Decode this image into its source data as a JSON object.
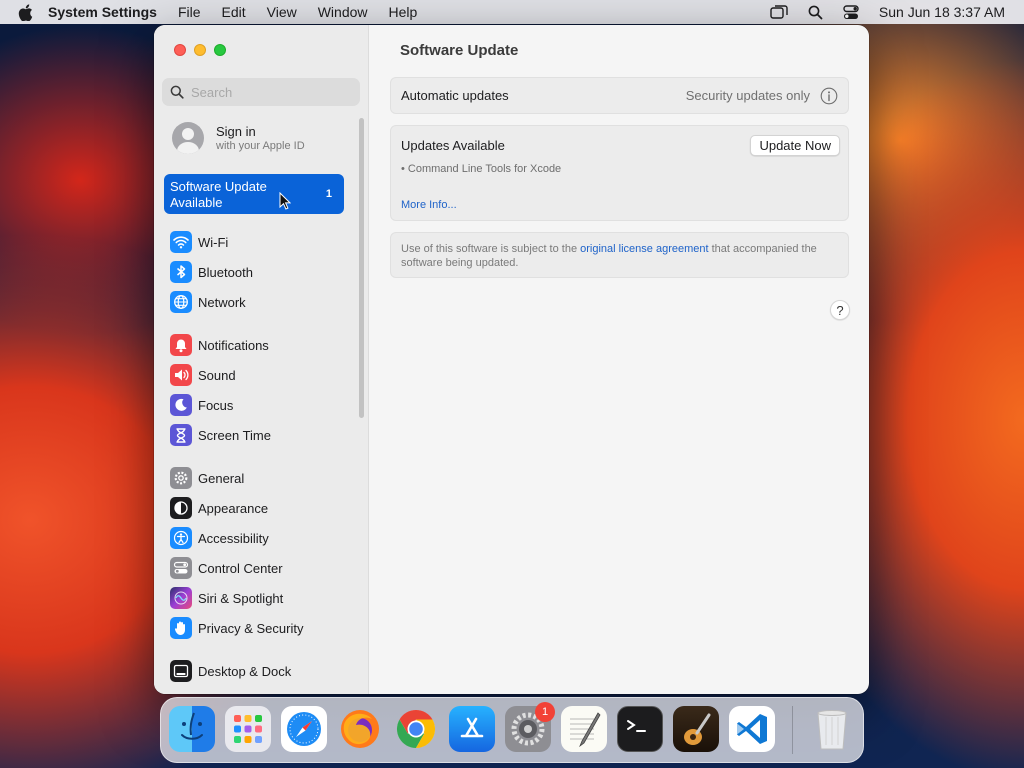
{
  "menubar": {
    "app_name": "System Settings",
    "menus": [
      "File",
      "Edit",
      "View",
      "Window",
      "Help"
    ],
    "clock": "Sun Jun 18  3:37 AM"
  },
  "sidebar": {
    "search_placeholder": "Search",
    "signin": {
      "title": "Sign in",
      "subtitle": "with your Apple ID"
    },
    "software_update": {
      "line1": "Software Update",
      "line2": "Available",
      "badge": "1"
    },
    "items": [
      {
        "label": "Wi-Fi",
        "icon": "wifi-icon",
        "color": "#1a8cff"
      },
      {
        "label": "Bluetooth",
        "icon": "bluetooth-icon",
        "color": "#1a8cff"
      },
      {
        "label": "Network",
        "icon": "globe-icon",
        "color": "#1a8cff"
      },
      {
        "label": "Notifications",
        "icon": "bell-icon",
        "color": "#f2474a"
      },
      {
        "label": "Sound",
        "icon": "speaker-icon",
        "color": "#f2474a"
      },
      {
        "label": "Focus",
        "icon": "moon-icon",
        "color": "#5c56d6"
      },
      {
        "label": "Screen Time",
        "icon": "hourglass-icon",
        "color": "#5c56d6"
      },
      {
        "label": "General",
        "icon": "gear-icon",
        "color": "#8e8e93"
      },
      {
        "label": "Appearance",
        "icon": "appearance-icon",
        "color": "#1d1d1f"
      },
      {
        "label": "Accessibility",
        "icon": "accessibility-icon",
        "color": "#1a8cff"
      },
      {
        "label": "Control Center",
        "icon": "toggles-icon",
        "color": "#8e8e93"
      },
      {
        "label": "Siri & Spotlight",
        "icon": "siri-icon",
        "color": "#9a3fd6"
      },
      {
        "label": "Privacy & Security",
        "icon": "hand-icon",
        "color": "#1a8cff"
      },
      {
        "label": "Desktop & Dock",
        "icon": "dock-icon",
        "color": "#1d1d1f"
      }
    ]
  },
  "content": {
    "title": "Software Update",
    "automatic_updates": {
      "label": "Automatic updates",
      "value": "Security updates only"
    },
    "updates": {
      "header": "Updates Available",
      "button": "Update Now",
      "item": "• Command Line Tools for Xcode",
      "more": "More Info..."
    },
    "license": {
      "pre": "Use of this software is subject to the ",
      "link": "original license agreement",
      "post": " that accompanied the software being updated."
    },
    "help": "?"
  },
  "dock": {
    "apps": [
      "finder",
      "launchpad",
      "safari",
      "firefox",
      "chrome",
      "app-store",
      "system-settings",
      "textedit",
      "terminal",
      "garageband",
      "vscode",
      "trash"
    ],
    "settings_badge": "1"
  }
}
